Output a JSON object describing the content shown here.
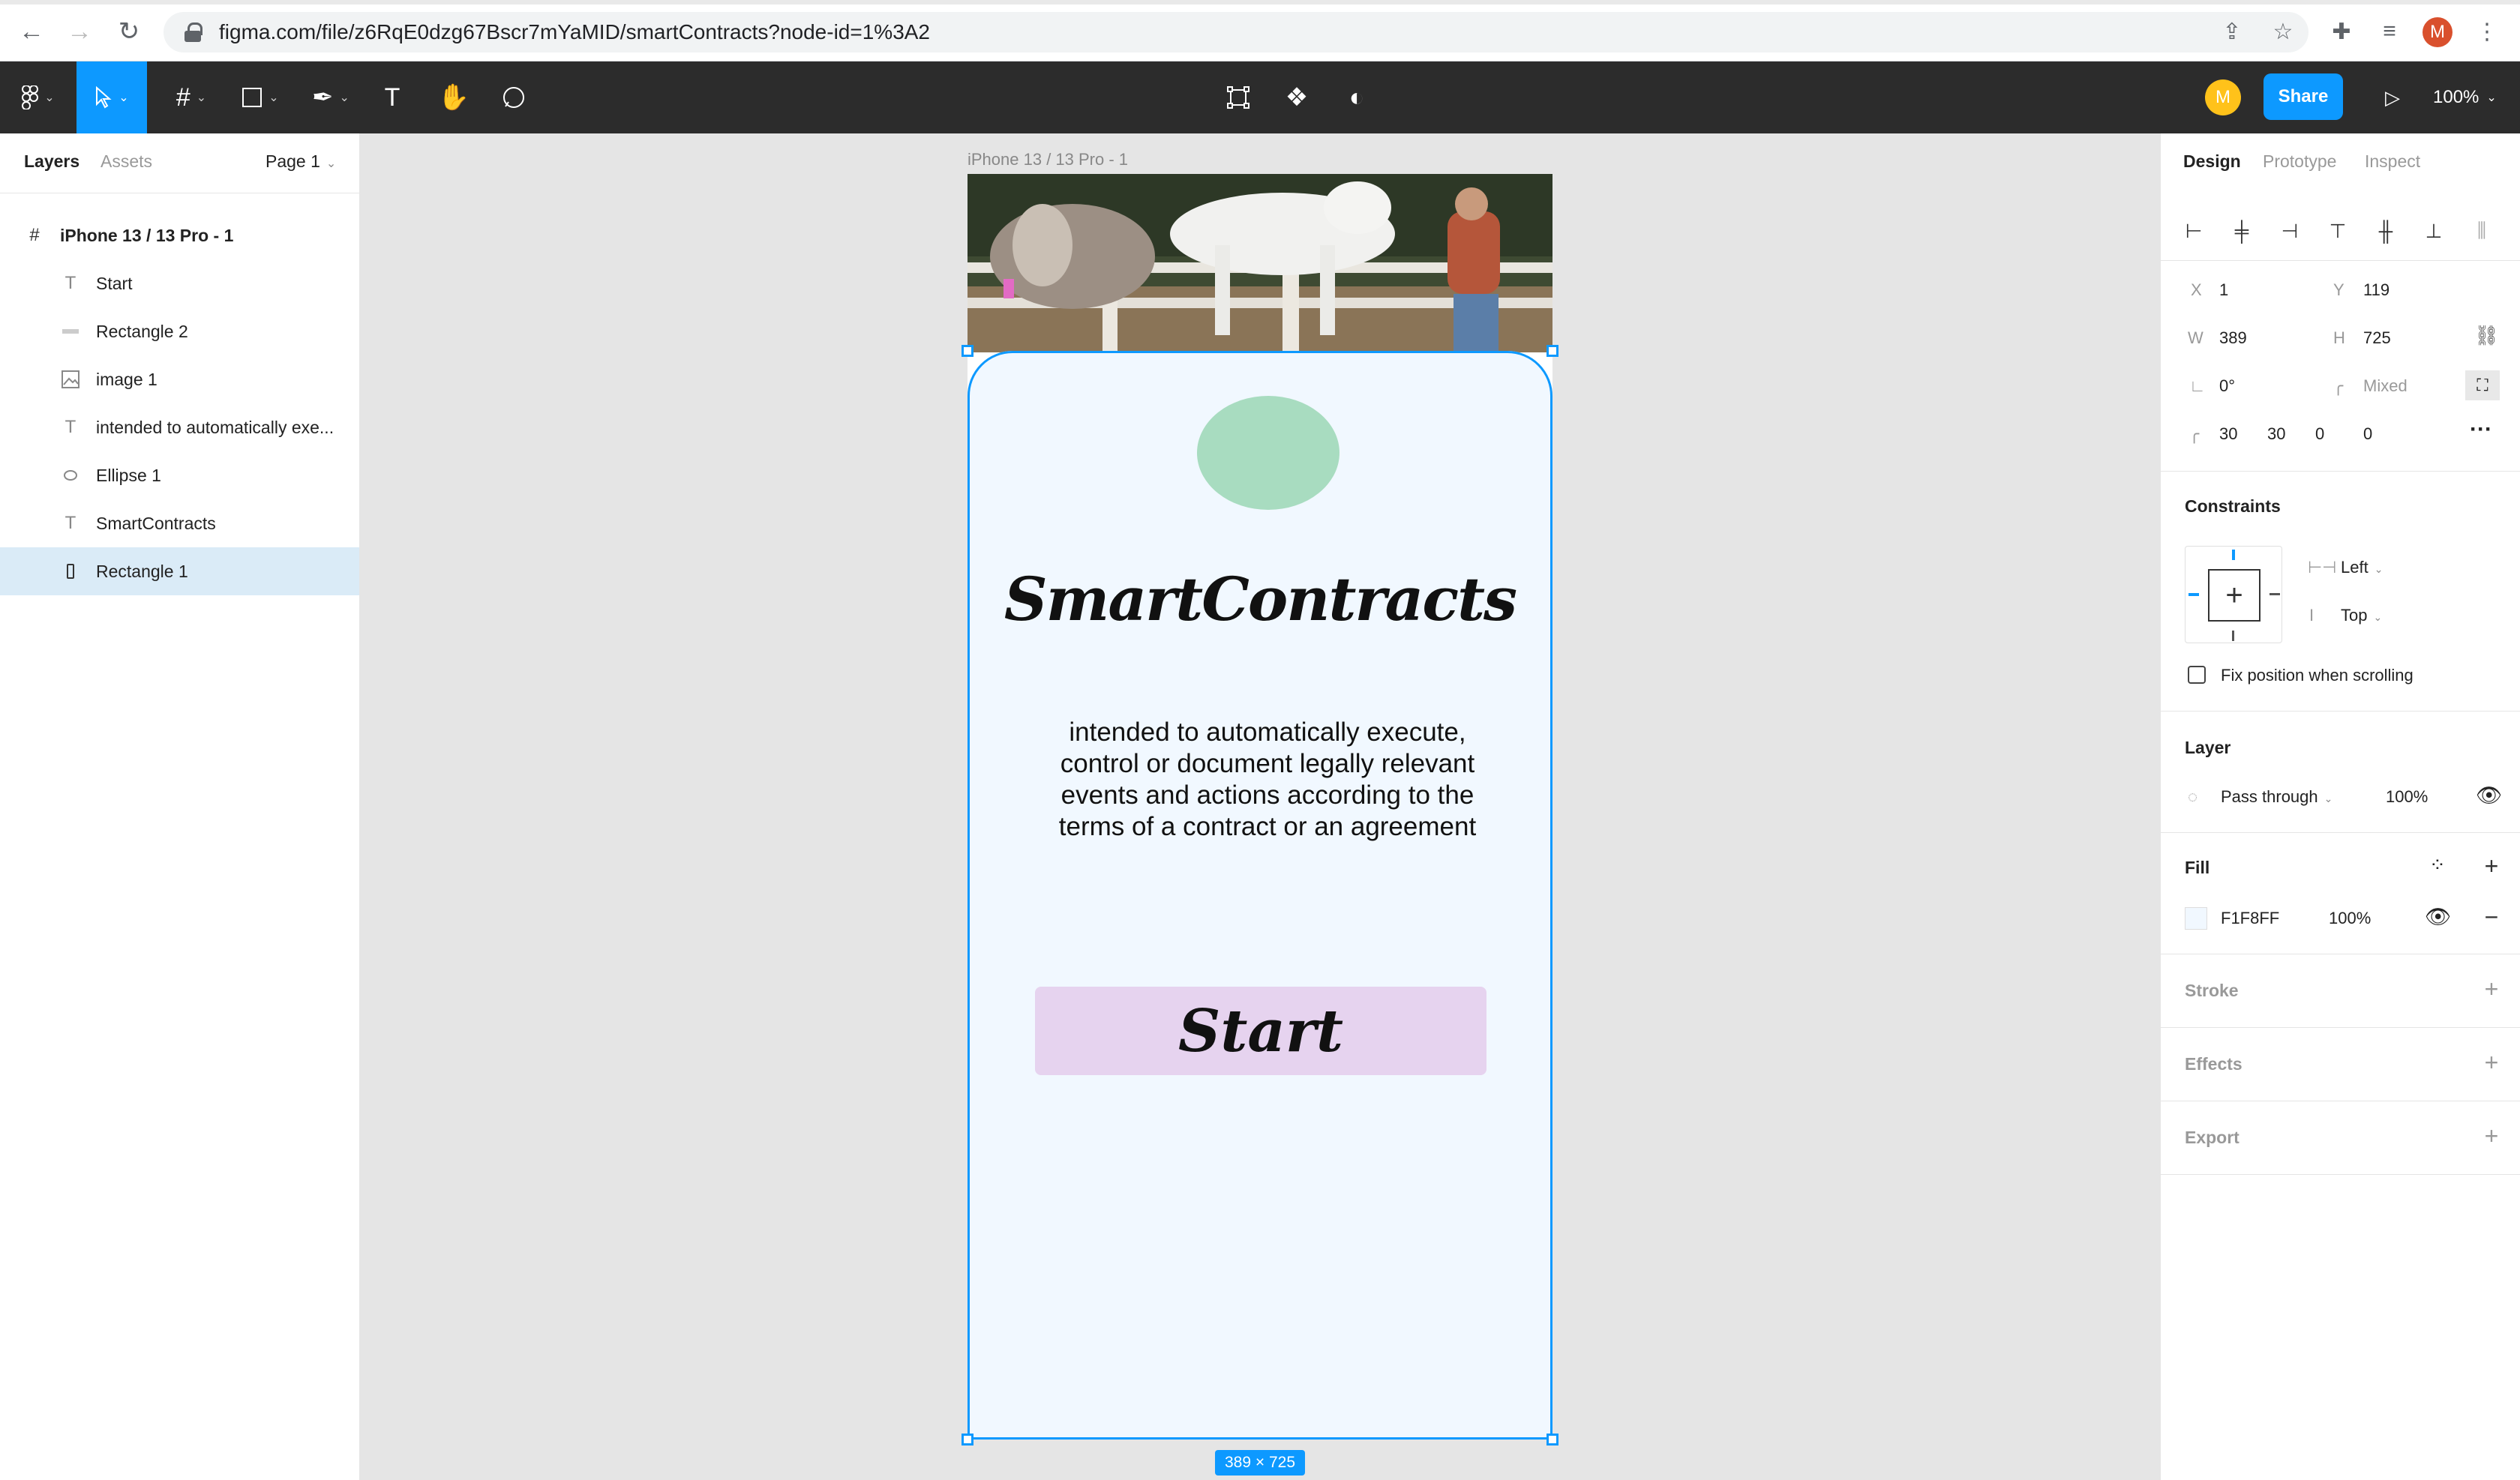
{
  "browser": {
    "url": "figma.com/file/z6RqE0dzg67Bscr7mYaMID/smartContracts?node-id=1%3A2",
    "profile_initial": "M"
  },
  "toolbar": {
    "avatar_initial": "M",
    "share_label": "Share",
    "zoom_label": "100%"
  },
  "left_panel": {
    "tabs": [
      "Layers",
      "Assets"
    ],
    "page_label": "Page 1",
    "frame_name": "iPhone 13 / 13 Pro - 1",
    "layers": [
      {
        "label": "Start",
        "icon": "text-icon"
      },
      {
        "label": "Rectangle 2",
        "icon": "rectangle-icon"
      },
      {
        "label": "image 1",
        "icon": "image-icon"
      },
      {
        "label": "intended to automatically exe...",
        "icon": "text-icon"
      },
      {
        "label": "Ellipse 1",
        "icon": "ellipse-icon"
      },
      {
        "label": "SmartContracts",
        "icon": "text-icon"
      },
      {
        "label": "Rectangle 1",
        "icon": "rectangle-icon",
        "selected": true
      }
    ]
  },
  "canvas": {
    "frame_title": "iPhone 13 / 13 Pro - 1",
    "app_title": "SmartContracts",
    "description": "intended to automatically execute, control or document legally relevant events and actions according to the terms of a contract or an agreement",
    "start_label": "Start",
    "dims_badge": "389 × 725",
    "help_label": "?"
  },
  "right_panel": {
    "tabs": [
      "Design",
      "Prototype",
      "Inspect"
    ],
    "x_label": "X",
    "x_value": "1",
    "y_label": "Y",
    "y_value": "119",
    "w_label": "W",
    "w_value": "389",
    "h_label": "H",
    "h_value": "725",
    "rotation_value": "0°",
    "radius_value": "Mixed",
    "corner_values": [
      "30",
      "30",
      "0",
      "0"
    ],
    "constraints_title": "Constraints",
    "constraint_h": "Left",
    "constraint_v": "Top",
    "fix_position_label": "Fix position when scrolling",
    "layer_title": "Layer",
    "blend_mode": "Pass through",
    "layer_opacity": "100%",
    "fill_title": "Fill",
    "fill_hex": "F1F8FF",
    "fill_opacity": "100%",
    "stroke_title": "Stroke",
    "effects_title": "Effects",
    "export_title": "Export"
  },
  "colors": {
    "accent": "#0d99ff",
    "fill": "#f1f8ff",
    "ellipse": "#a8dcc0",
    "start_button": "#e6d3ef",
    "toolbar_bg": "#2c2c2c"
  }
}
